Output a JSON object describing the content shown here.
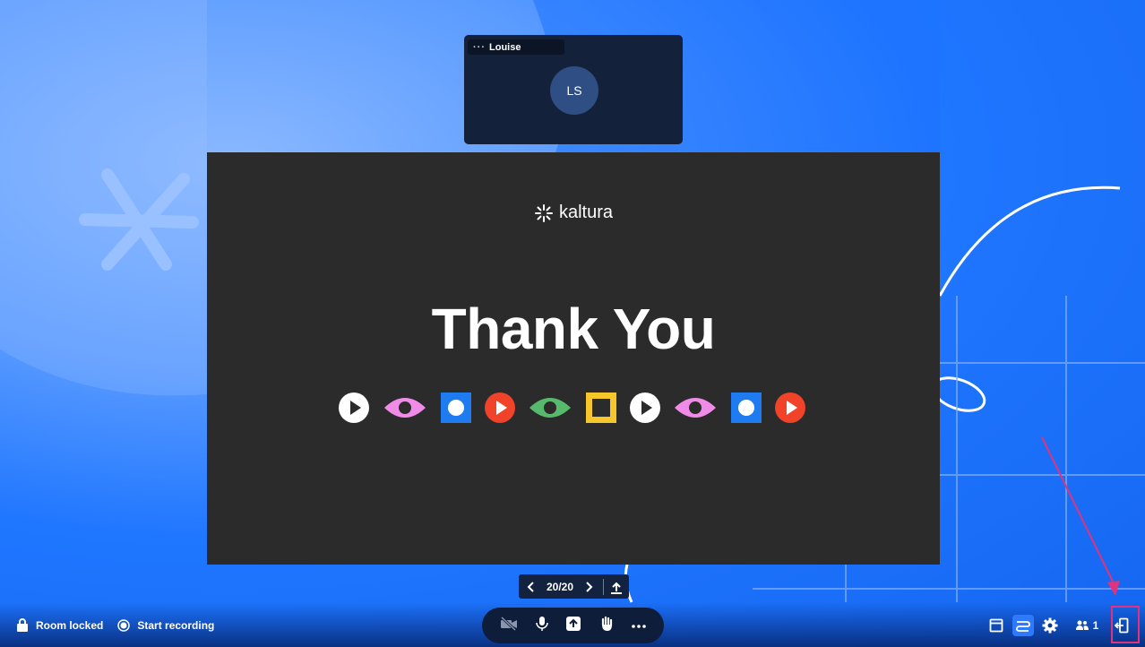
{
  "participant": {
    "name": "Louise",
    "initials": "LS",
    "menu": "···"
  },
  "slide": {
    "brand": "kaltura",
    "title": "Thank You",
    "icons": [
      "play-white",
      "eye-pink",
      "square-blue",
      "play-red",
      "eye-green",
      "square-yellow",
      "play-white",
      "eye-pink",
      "square-blue",
      "play-red"
    ]
  },
  "pager": {
    "current": "20/20"
  },
  "bottom": {
    "room_locked": "Room locked",
    "start_recording": "Start recording",
    "participants_count": "1"
  },
  "colors": {
    "accent": "#2f79ff",
    "highlight": "#e0337b",
    "tile_bg": "#14213a",
    "slide_bg": "#2b2b2b"
  }
}
